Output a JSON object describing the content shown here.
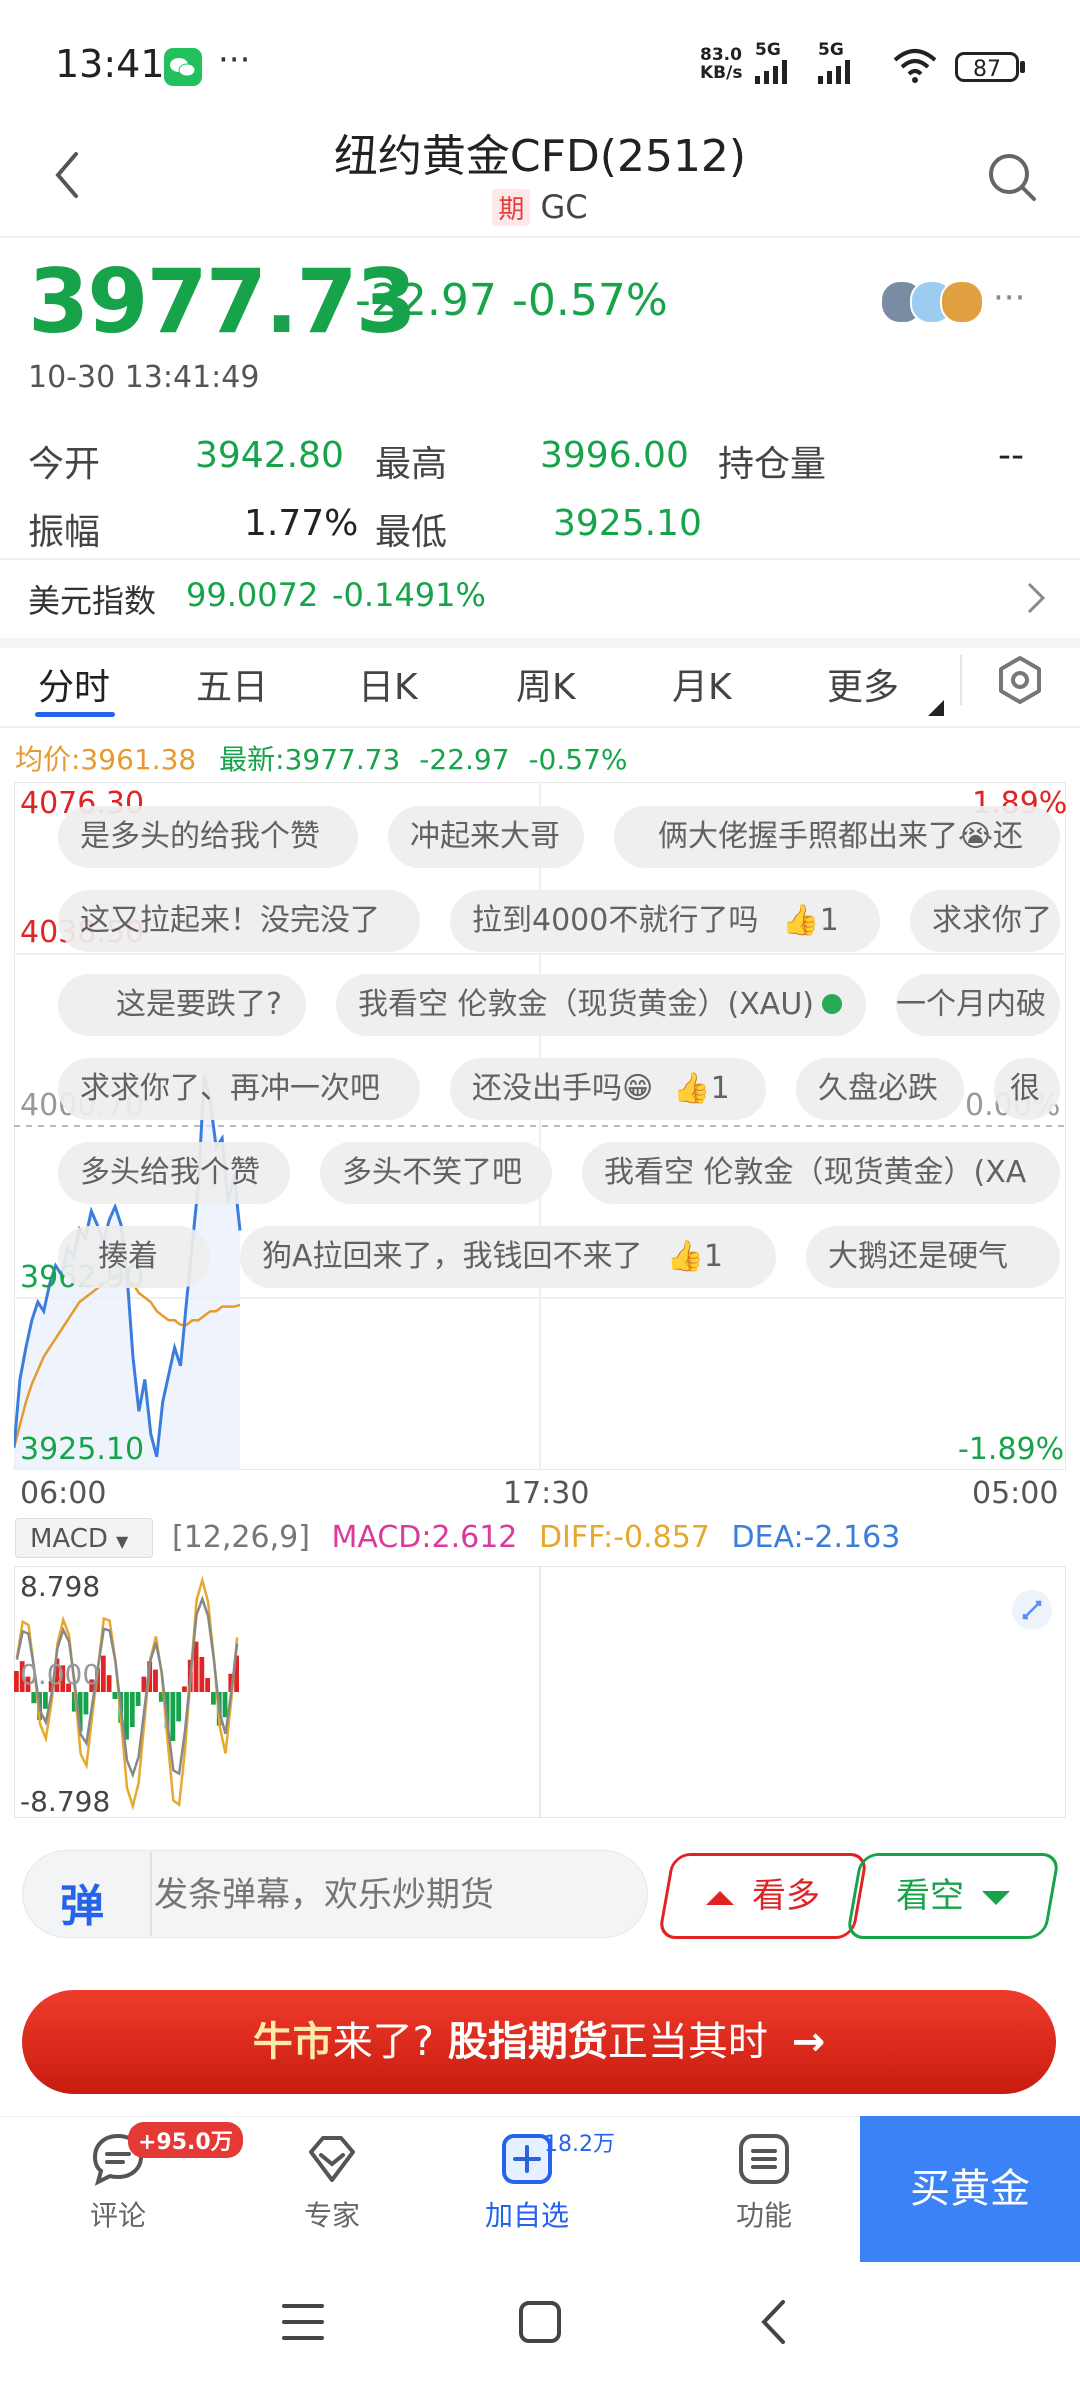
{
  "status_bar": {
    "time": "13:41",
    "net_speed_value": "83.0",
    "net_speed_unit": "KB/s",
    "signal_1": "5G",
    "signal_2": "5G",
    "battery": "87"
  },
  "header": {
    "title": "纽约黄金CFD(2512)",
    "tag": "期",
    "code": "GC"
  },
  "quote": {
    "price": "3977.73",
    "change": "-22.97",
    "change_pct": "-0.57%",
    "timestamp": "10-30 13:41:49",
    "open_label": "今开",
    "open_value": "3942.80",
    "high_label": "最高",
    "high_value": "3996.00",
    "oi_label": "持仓量",
    "oi_value": "--",
    "amp_label": "振幅",
    "amp_value": "1.77%",
    "low_label": "最低",
    "low_value": "3925.10"
  },
  "usd_index": {
    "label": "美元指数",
    "value": "99.0072",
    "change_pct": "-0.1491%"
  },
  "tabs": [
    "分时",
    "五日",
    "日K",
    "周K",
    "月K",
    "更多"
  ],
  "chart_info": {
    "avg_label": "均价:3961.38",
    "latest_label": "最新:3977.73",
    "change": "-22.97",
    "change_pct": "-0.57%"
  },
  "chart_data": {
    "type": "line",
    "y_ticks_left": [
      "4076.30",
      "4038.50",
      "4000.70",
      "3962.90",
      "3925.10"
    ],
    "y_ticks_right": [
      "1.89%",
      "0.00%",
      "-1.89%"
    ],
    "x_ticks": [
      "06:00",
      "17:30",
      "05:00"
    ],
    "ylim": [
      3925.1,
      4076.3
    ],
    "series": [
      {
        "name": "最新",
        "values": [
          3930,
          3945,
          3952,
          3958,
          3962,
          3960,
          3966,
          3970,
          3968,
          3974,
          3972,
          3978,
          3976,
          3982,
          3979,
          3975,
          3980,
          3983,
          3979,
          3968,
          3950,
          3938,
          3945,
          3933,
          3928,
          3940,
          3946,
          3952,
          3948,
          3962,
          3975,
          3988,
          4012,
          4006,
          3996,
          3998,
          3984,
          3990,
          3977.73
        ]
      },
      {
        "name": "均价",
        "values": [
          3930,
          3935,
          3940,
          3944,
          3947,
          3950,
          3952,
          3954,
          3956,
          3958,
          3960,
          3962,
          3963,
          3964,
          3965,
          3966,
          3967,
          3968,
          3968,
          3967,
          3966,
          3964,
          3963,
          3962,
          3960,
          3959,
          3958,
          3958,
          3957,
          3957,
          3958,
          3958,
          3959,
          3960,
          3960,
          3961,
          3961,
          3961,
          3961.38
        ]
      }
    ]
  },
  "danmu": [
    "是多头的给我个赞",
    "冲起来大哥",
    "俩大佬握手照都出来了😭还",
    "这又拉起来！没完没了",
    "拉到4000不就行了吗",
    "求求你了",
    "这是要跌了?",
    "我看空 伦敦金（现货黄金）(XAU)",
    "一个月内破",
    "求求你了、再冲一次吧",
    "还没出手吗😁",
    "久盘必跌",
    "很",
    "多头给我个赞",
    "多头不笑了吧",
    "我看空 伦敦金（现货黄金）(XA",
    "揍着",
    "狗A拉回来了，我钱回不来了",
    "大鹅还是硬气"
  ],
  "danmu_likes": [
    "1",
    "1",
    "1"
  ],
  "macd": {
    "selector": "MACD",
    "params": "[12,26,9]",
    "macd": "MACD:2.612",
    "diff": "DIFF:-0.857",
    "dea": "DEA:-2.163",
    "y_top": "8.798",
    "y_mid": "0.000",
    "y_bottom": "-8.798",
    "histogram": [
      1.5,
      2.2,
      1.1,
      -0.8,
      -2.0,
      -1.2,
      0.8,
      2.4,
      1.9,
      0.6,
      -1.4,
      -2.8,
      -1.6,
      0.9,
      1.7,
      2.6,
      1.2,
      -0.5,
      -2.2,
      -3.4,
      -2.5,
      -1.0,
      1.1,
      2.2,
      1.6,
      -0.7,
      -2.6,
      -3.5,
      -2.1,
      0.4,
      2.3,
      3.6,
      2.5,
      1.0,
      -0.9,
      -2.4,
      -1.8,
      1.3,
      2.6
    ]
  },
  "actions": {
    "danmu_placeholder": "发条弹幕，欢乐炒期货",
    "danmu_icon": "弹",
    "bull": "看多",
    "bear": "看空"
  },
  "banner": {
    "part1": "牛市",
    "part2": "来了?",
    "part3": "股指期货",
    "part4": "正当其时",
    "arrow": "→"
  },
  "bottom_nav": {
    "comments": "评论",
    "comments_badge": "+95.0万",
    "experts": "专家",
    "add_watch": "加自选",
    "add_watch_count": "18.2万",
    "functions": "功能",
    "buy": "买黄金"
  },
  "colors": {
    "up": "#e02424",
    "down": "#16a34a",
    "accent": "#2563eb",
    "avg_line": "#e69a2e"
  }
}
